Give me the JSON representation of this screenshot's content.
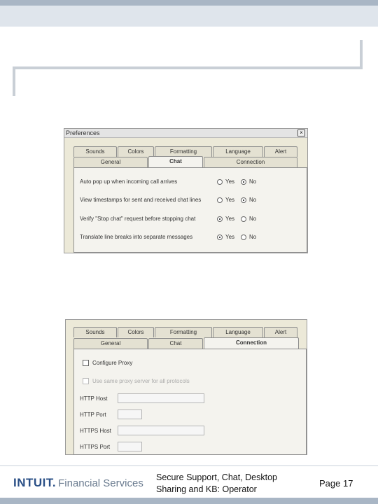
{
  "dialog1": {
    "title": "Preferences",
    "close_glyph": "×",
    "tabs_row1": [
      "Sounds",
      "Colors",
      "Formatting",
      "Language",
      "Alert"
    ],
    "tabs_row2": [
      "General",
      "Chat",
      "Connection"
    ],
    "active_tab": "Chat",
    "options": [
      {
        "label": "Auto pop up when incoming call arrives",
        "yes": "Yes",
        "no": "No",
        "selected": "No"
      },
      {
        "label": "View timestamps for sent and received chat lines",
        "yes": "Yes",
        "no": "No",
        "selected": "No"
      },
      {
        "label": "Verify \"Stop chat\" request before stopping chat",
        "yes": "Yes",
        "no": "No",
        "selected": "Yes"
      },
      {
        "label": "Translate line breaks into separate messages",
        "yes": "Yes",
        "no": "No",
        "selected": "Yes"
      }
    ]
  },
  "dialog2": {
    "tabs_row1": [
      "Sounds",
      "Colors",
      "Formatting",
      "Language",
      "Alert"
    ],
    "tabs_row2": [
      "General",
      "Chat",
      "Connection"
    ],
    "active_tab": "Connection",
    "configure_proxy": "Configure Proxy",
    "same_proxy": "Use same proxy server for all protocols",
    "fields": [
      "HTTP Host",
      "HTTP Port",
      "HTTPS Host",
      "HTTPS Port"
    ]
  },
  "footer": {
    "brand": "INTUIT.",
    "division": "Financial Services",
    "title_line1": "Secure Support, Chat, Desktop",
    "title_line2": "Sharing and KB: Operator",
    "page": "Page 17"
  },
  "colors": {
    "brand_blue": "#2a4f86",
    "band": "#a9b6c5"
  }
}
